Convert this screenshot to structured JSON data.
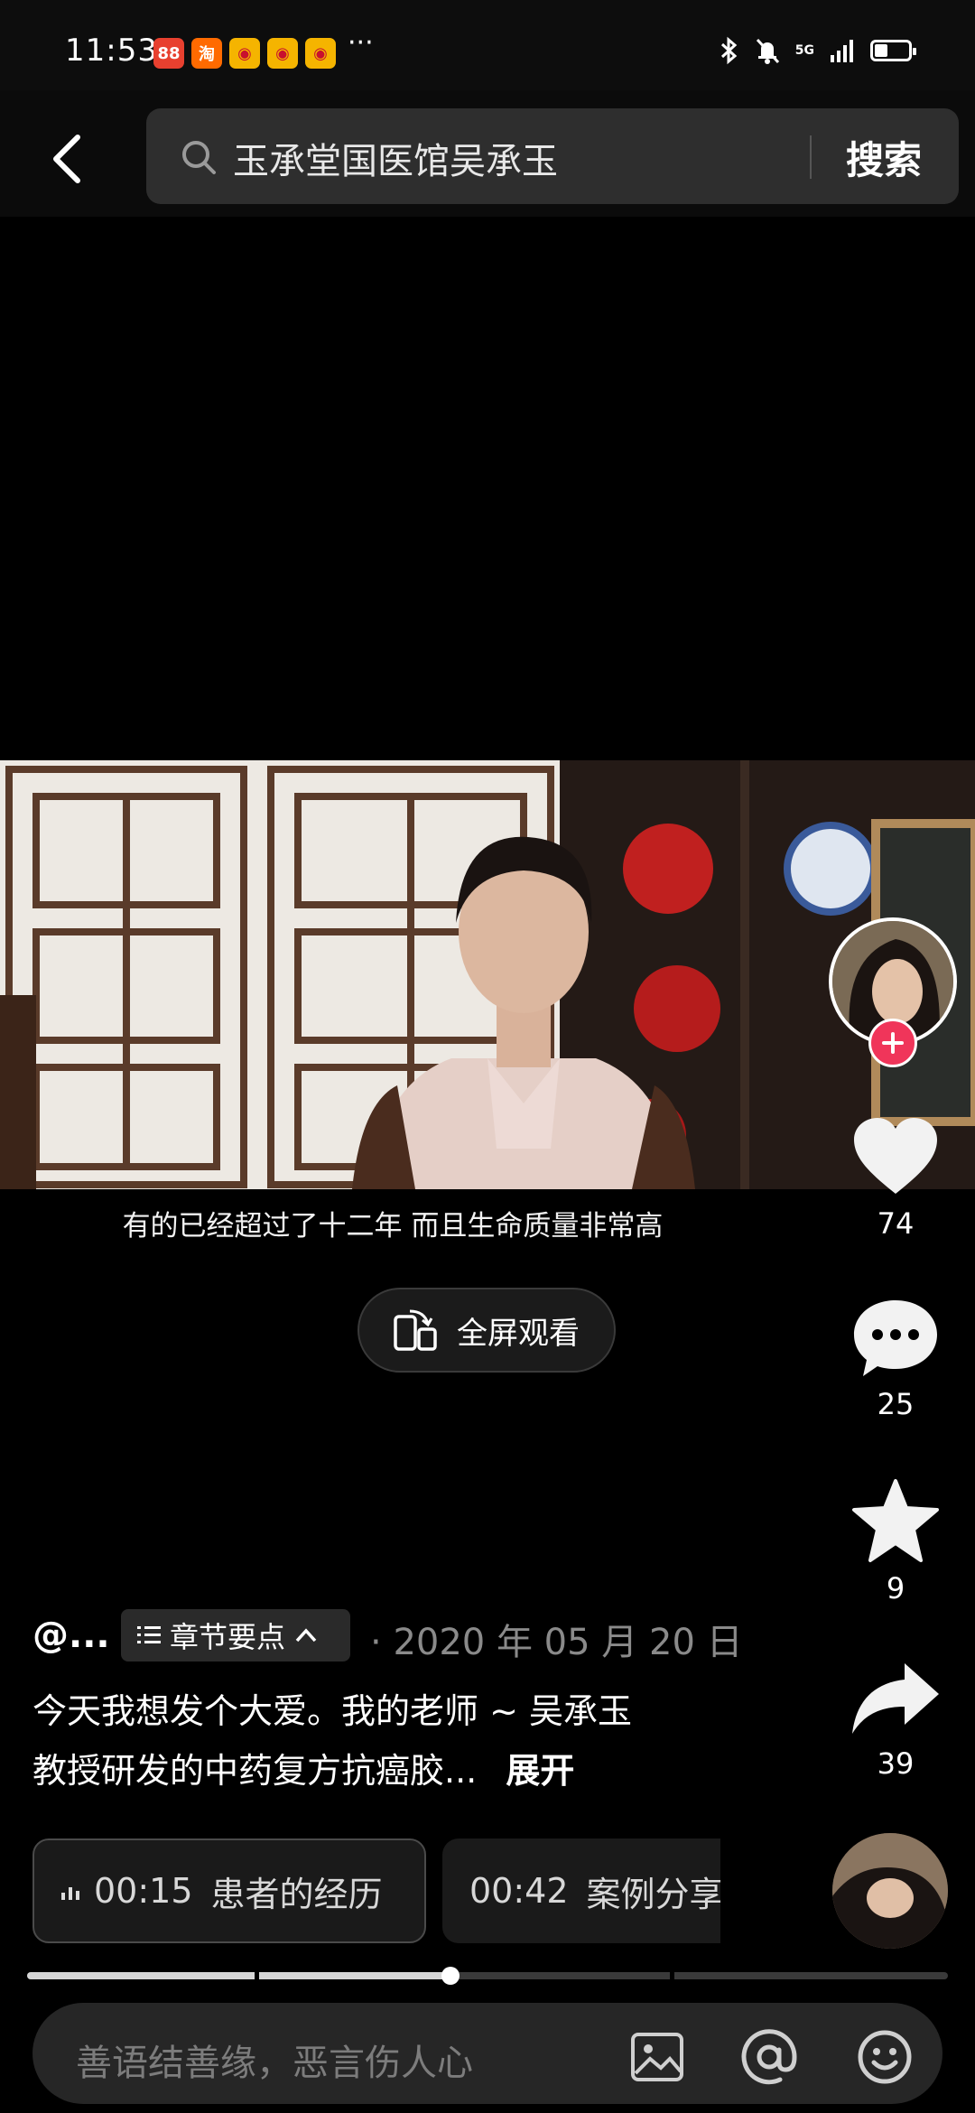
{
  "status_bar": {
    "time": "11:53",
    "app_icons": [
      {
        "name": "app-icon-1",
        "glyph": "88",
        "color": "#e8402f"
      },
      {
        "name": "taobao-icon",
        "glyph": "淘",
        "color": "#ff6a00"
      },
      {
        "name": "weibo-icon-1",
        "glyph": "◉",
        "color": "#f5b400"
      },
      {
        "name": "weibo-icon-2",
        "glyph": "◉",
        "color": "#f5b400"
      },
      {
        "name": "weibo-icon-3",
        "glyph": "◉",
        "color": "#f5b400"
      }
    ],
    "more": "···",
    "network": "5G",
    "battery_level": 0.4
  },
  "header": {
    "search_query": "玉承堂国医馆吴承玉",
    "search_button": "搜索"
  },
  "video": {
    "subtitle": "有的已经超过了十二年  而且生命质量非常高",
    "fullscreen_label": "全屏观看"
  },
  "rail": {
    "like_count": "74",
    "comment_count": "25",
    "favorite_count": "9",
    "share_count": "39"
  },
  "info": {
    "author": "@...",
    "chapter_tag": "章节要点",
    "date_prefix": "·",
    "date": "2020 年 05 月 20 日",
    "description_line1": "今天我想发个大爱。我的老师 ~ 吴承玉",
    "description_line2": "教授研发的中药复方抗癌胶...",
    "expand": "展开"
  },
  "chapters": [
    {
      "time": "00:15",
      "title": "患者的经历"
    },
    {
      "time": "00:42",
      "title": "案例分享"
    }
  ],
  "progress": {
    "played_fraction": 0.46
  },
  "comment": {
    "placeholder": "善语结善缘，恶言伤人心"
  },
  "colors": {
    "accent_red": "#f0355a",
    "background": "#000000"
  }
}
